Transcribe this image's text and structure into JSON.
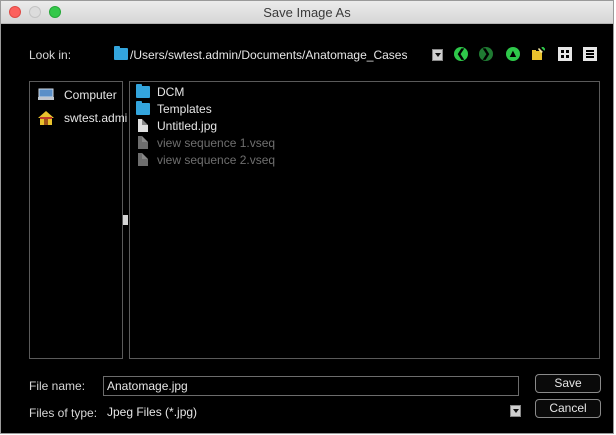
{
  "window": {
    "title": "Save Image As"
  },
  "look_in": {
    "label": "Look in:",
    "path": "/Users/swtest.admin/Documents/Anatomage_Cases"
  },
  "toolbar": {
    "icons": [
      "back-icon",
      "forward-icon",
      "up-icon",
      "new-folder-icon",
      "list-view-icon",
      "detail-view-icon"
    ],
    "colors": {
      "back": "#2ec84a",
      "forward": "#1f7a32",
      "up": "#2ec84a",
      "folder": "#e9c22d"
    }
  },
  "places": [
    {
      "label": "Computer",
      "icon": "computer-icon"
    },
    {
      "label": "swtest.admi",
      "icon": "home-icon"
    }
  ],
  "files": [
    {
      "name": "DCM",
      "type": "folder",
      "dim": false
    },
    {
      "name": "Templates",
      "type": "folder",
      "dim": false
    },
    {
      "name": "Untitled.jpg",
      "type": "file",
      "dim": false
    },
    {
      "name": "view sequence 1.vseq",
      "type": "file",
      "dim": true
    },
    {
      "name": "view sequence 2.vseq",
      "type": "file",
      "dim": true
    }
  ],
  "file_name": {
    "label": "File name:",
    "value": "Anatomage.jpg"
  },
  "file_type": {
    "label": "Files of type:",
    "value": "Jpeg Files (*.jpg)"
  },
  "buttons": {
    "save": "Save",
    "cancel": "Cancel"
  },
  "colors": {
    "accent": "#33a5dd",
    "background": "#000000",
    "close": "#fc615d",
    "zoom": "#34c84a"
  }
}
